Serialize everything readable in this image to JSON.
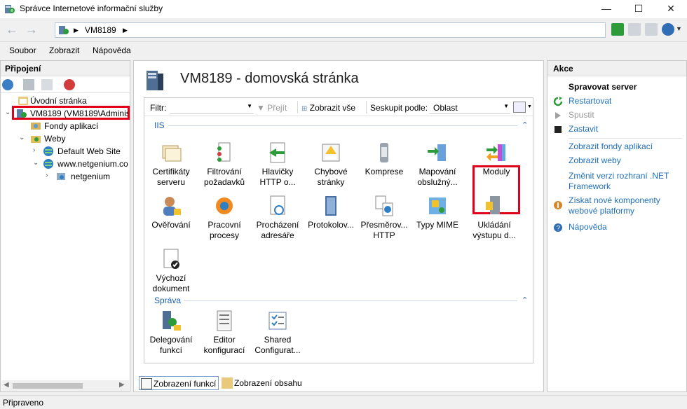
{
  "window": {
    "title": "Správce Internetové informační služby",
    "minimize": "—",
    "maximize": "☐",
    "close": "✕"
  },
  "address": {
    "crumbs": [
      "VM8189"
    ],
    "sep": "▶"
  },
  "menu": [
    "Soubor",
    "Zobrazit",
    "Nápověda"
  ],
  "connections": {
    "header": "Připojení",
    "tree": [
      {
        "label": "Úvodní stránka",
        "icon": "start-page-icon"
      },
      {
        "label": "VM8189 (VM8189\\Adminis",
        "icon": "server-icon",
        "selected": true
      },
      {
        "label": "Fondy aplikací",
        "icon": "app-pools-icon"
      },
      {
        "label": "Weby",
        "icon": "sites-folder-icon"
      },
      {
        "label": "Default Web Site",
        "icon": "globe-icon"
      },
      {
        "label": "www.netgenium.co",
        "icon": "globe-icon"
      },
      {
        "label": "netgenium",
        "icon": "app-icon"
      }
    ]
  },
  "main": {
    "title": "VM8189 - domovská stránka",
    "filter": {
      "label": "Filtr:",
      "go": "Přejít",
      "show_all": "Zobrazit vše",
      "group_by": "Seskupit podle:",
      "group_value": "Oblast"
    },
    "groups": [
      {
        "name": "IIS",
        "features": [
          {
            "label": "Certifikáty serveru",
            "icon": "certificates-icon"
          },
          {
            "label": "Filtrování požadavků",
            "icon": "request-filtering-icon"
          },
          {
            "label": "Hlavičky HTTP o...",
            "icon": "http-headers-icon"
          },
          {
            "label": "Chybové stránky",
            "icon": "error-pages-icon"
          },
          {
            "label": "Komprese",
            "icon": "compression-icon"
          },
          {
            "label": "Mapování obslužný...",
            "icon": "handler-mappings-icon"
          },
          {
            "label": "Moduly",
            "icon": "modules-icon",
            "highlighted": true
          },
          {
            "label": "Ověřování",
            "icon": "authentication-icon"
          },
          {
            "label": "Pracovní procesy",
            "icon": "worker-processes-icon"
          },
          {
            "label": "Procházení adresáře",
            "icon": "directory-browsing-icon"
          },
          {
            "label": "Protokolov...",
            "icon": "logging-icon"
          },
          {
            "label": "Přesměrov... HTTP",
            "icon": "http-redirect-icon"
          },
          {
            "label": "Typy MIME",
            "icon": "mime-types-icon"
          },
          {
            "label": "Ukládání výstupu d...",
            "icon": "output-caching-icon"
          },
          {
            "label": "Výchozí dokument",
            "icon": "default-document-icon"
          }
        ]
      },
      {
        "name": "Správa",
        "features": [
          {
            "label": "Delegování funkcí",
            "icon": "feature-delegation-icon"
          },
          {
            "label": "Editor konfigurací",
            "icon": "config-editor-icon"
          },
          {
            "label": "Shared Configurat...",
            "icon": "shared-config-icon"
          }
        ]
      }
    ],
    "view_tabs": [
      "Zobrazení funkcí",
      "Zobrazení obsahu"
    ]
  },
  "actions": {
    "header": "Akce",
    "manage_title": "Spravovat server",
    "items": [
      {
        "label": "Restartovat",
        "enabled": true,
        "icon": "restart-icon"
      },
      {
        "label": "Spustit",
        "enabled": false,
        "icon": "start-icon"
      },
      {
        "label": "Zastavit",
        "enabled": true,
        "icon": "stop-icon"
      },
      {
        "label": "Zobrazit fondy aplikací",
        "enabled": true
      },
      {
        "label": "Zobrazit weby",
        "enabled": true
      },
      {
        "label": "Změnit verzi rozhraní .NET Framework",
        "enabled": true
      },
      {
        "label": "Získat nové komponenty webové platformy",
        "enabled": true,
        "icon": "web-platform-icon"
      },
      {
        "label": "Nápověda",
        "enabled": true,
        "icon": "help-icon"
      }
    ]
  },
  "status": "Připraveno",
  "colors": {
    "link": "#1f6fb8",
    "highlight": "#e0001a",
    "group": "#1a5fb4"
  }
}
